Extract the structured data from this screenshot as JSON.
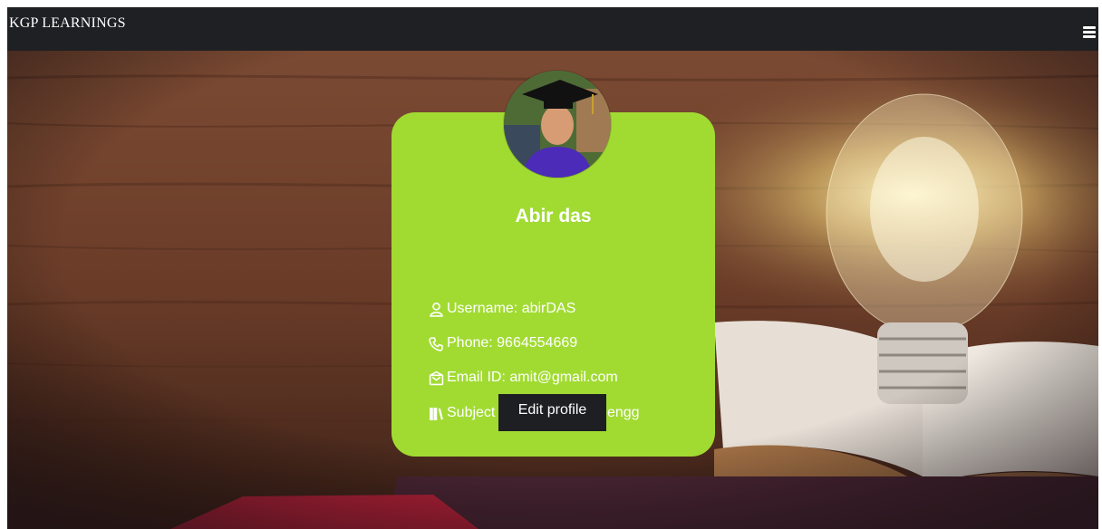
{
  "navbar": {
    "brand": "KGP LEARNINGS",
    "menu_icon": "hamburger-menu-icon"
  },
  "profile": {
    "name": "Abir das",
    "fields": [
      {
        "icon": "user-icon",
        "text": "Username: abirDAS"
      },
      {
        "icon": "phone-icon",
        "text": "Phone: 9664554669"
      },
      {
        "icon": "envelope-icon",
        "text": "Email ID: amit@gmail.com"
      },
      {
        "icon": "books-icon",
        "text": "Subject Name: Software engg"
      }
    ],
    "edit_label": "Edit profile"
  },
  "colors": {
    "navbar": "#1f2023",
    "card": "#a1db32",
    "button": "#1e1f22"
  }
}
